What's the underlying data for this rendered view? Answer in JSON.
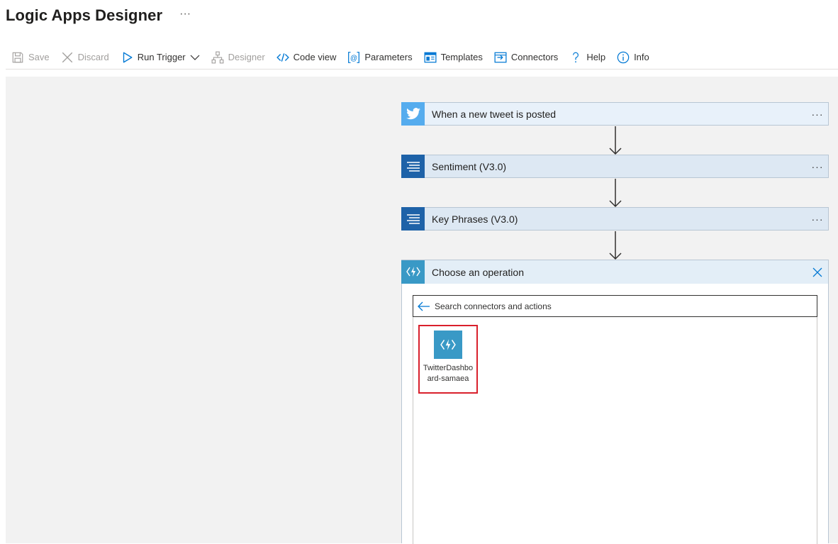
{
  "header": {
    "title": "Logic Apps Designer",
    "more": "···"
  },
  "toolbar": {
    "save": "Save",
    "discard": "Discard",
    "run_trigger": "Run Trigger",
    "designer": "Designer",
    "code_view": "Code view",
    "parameters": "Parameters",
    "templates": "Templates",
    "connectors": "Connectors",
    "help": "Help",
    "info": "Info"
  },
  "workflow": {
    "steps": [
      {
        "label": "When a new tweet is posted",
        "icon": "twitter-icon",
        "color": "#55acee",
        "more": "···"
      },
      {
        "label": "Sentiment (V3.0)",
        "icon": "text-analytics-icon",
        "color": "#1e62a8",
        "more": "···"
      },
      {
        "label": "Key Phrases (V3.0)",
        "icon": "text-analytics-icon",
        "color": "#1e62a8",
        "more": "···"
      }
    ],
    "operation": {
      "title": "Choose an operation",
      "icon": "function-app-icon",
      "color": "#3999c6",
      "search_placeholder": "Search connectors and actions",
      "results": [
        {
          "label": "TwitterDashboard-samaea",
          "icon": "function-app-icon"
        }
      ]
    }
  },
  "colors": {
    "accent": "#0078d4",
    "highlight": "#d9202c",
    "canvas": "#f2f2f2"
  }
}
